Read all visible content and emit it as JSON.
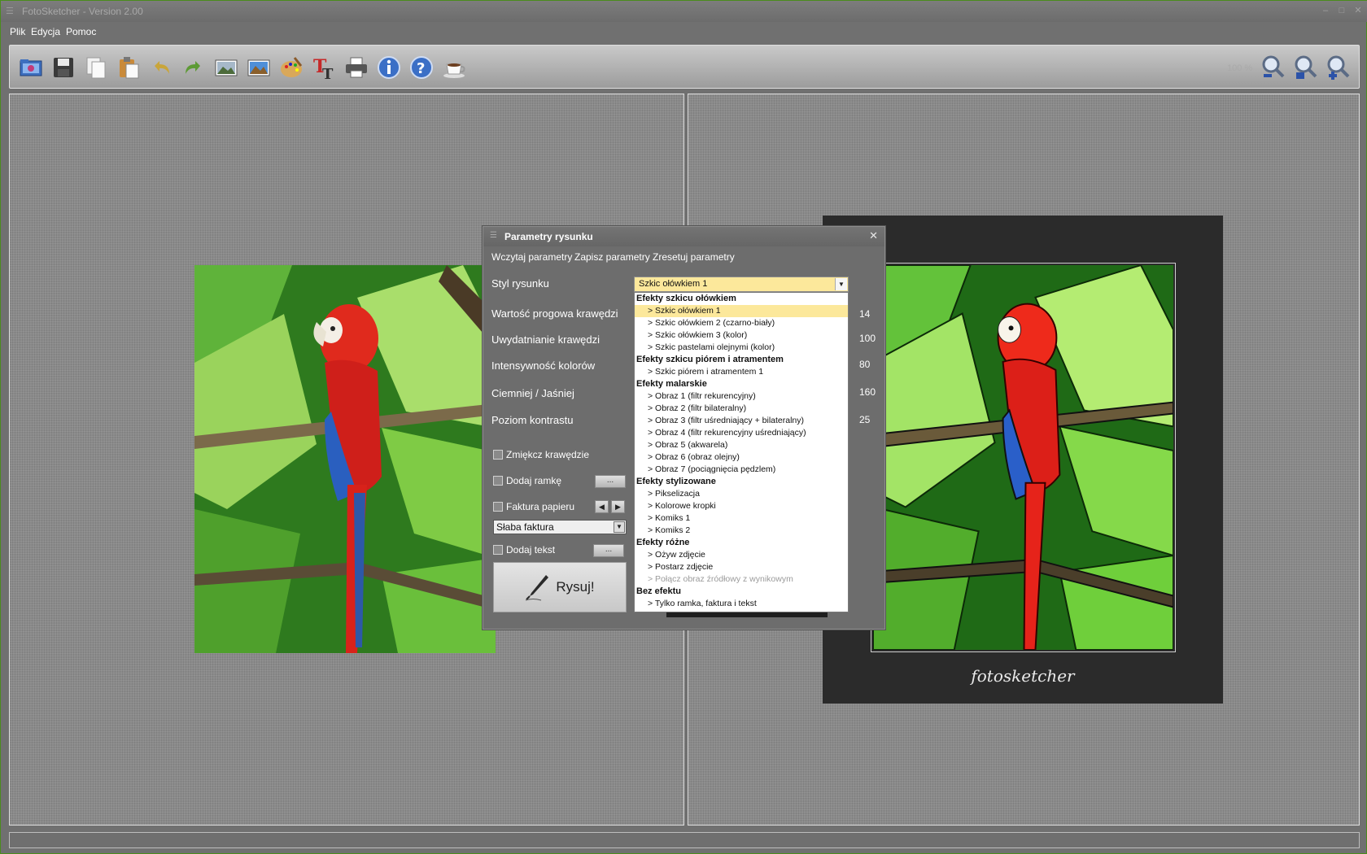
{
  "window": {
    "title": "FotoSketcher - Version 2.00"
  },
  "menu": [
    "Plik",
    "Edycja",
    "Pomoc"
  ],
  "toolbar": {
    "icons": [
      "open-icon",
      "save-icon",
      "copy-icon",
      "paste-icon",
      "undo-icon",
      "redo-icon",
      "source-image-icon",
      "result-image-icon",
      "palette-icon",
      "text-icon",
      "print-icon",
      "info-icon",
      "help-icon",
      "coffee-icon"
    ],
    "zoom_level": "100 %",
    "zoom_icons": [
      "zoom-out-icon",
      "zoom-fit-icon",
      "zoom-in-icon"
    ]
  },
  "right_image": {
    "signature": "fotosketcher"
  },
  "dialog": {
    "title": "Parametry rysunku",
    "links": {
      "load": "Wczytaj parametry",
      "save": "Zapisz parametry",
      "reset": "Zresetuj parametry"
    },
    "style_label": "Styl rysunku",
    "style_selected": "Szkic ołówkiem 1",
    "params": [
      {
        "label": "Wartość progowa krawędzi",
        "value": "14"
      },
      {
        "label": "Uwydatnianie krawędzi",
        "value": "100"
      },
      {
        "label": "Intensywność kolorów",
        "value": "80"
      },
      {
        "label": "Ciemniej / Jaśniej",
        "value": "160"
      },
      {
        "label": "Poziom kontrastu",
        "value": "25"
      }
    ],
    "checkboxes": {
      "soften": "Zmiękcz krawędzie",
      "frame": "Dodaj ramkę",
      "paper": "Faktura papieru",
      "text": "Dodaj tekst"
    },
    "dots": "...",
    "texture_value": "Słaba faktura",
    "draw_button": "Rysuj!",
    "style_list": [
      {
        "type": "group",
        "label": "Efekty szkicu ołówkiem"
      },
      {
        "type": "item",
        "label": ">  Szkic ołówkiem 1",
        "selected": true
      },
      {
        "type": "item",
        "label": ">  Szkic ołówkiem 2 (czarno-biały)"
      },
      {
        "type": "item",
        "label": ">  Szkic ołówkiem 3 (kolor)"
      },
      {
        "type": "item",
        "label": ">  Szkic pastelami olejnymi (kolor)"
      },
      {
        "type": "group",
        "label": "Efekty szkicu piórem i atramentem"
      },
      {
        "type": "item",
        "label": ">  Szkic piórem i atramentem 1"
      },
      {
        "type": "group",
        "label": "Efekty malarskie"
      },
      {
        "type": "item",
        "label": ">  Obraz 1 (filtr rekurencyjny)"
      },
      {
        "type": "item",
        "label": ">  Obraz 2 (filtr bilateralny)"
      },
      {
        "type": "item",
        "label": ">  Obraz 3 (filtr uśredniający + bilateralny)"
      },
      {
        "type": "item",
        "label": ">  Obraz 4 (filtr rekurencyjny uśredniający)"
      },
      {
        "type": "item",
        "label": ">  Obraz 5 (akwarela)"
      },
      {
        "type": "item",
        "label": ">  Obraz 6 (obraz olejny)"
      },
      {
        "type": "item",
        "label": ">  Obraz 7 (pociągnięcia pędzlem)"
      },
      {
        "type": "group",
        "label": "Efekty stylizowane"
      },
      {
        "type": "item",
        "label": ">  Pikselizacja"
      },
      {
        "type": "item",
        "label": ">  Kolorowe kropki"
      },
      {
        "type": "item",
        "label": ">  Komiks 1"
      },
      {
        "type": "item",
        "label": ">  Komiks 2"
      },
      {
        "type": "group",
        "label": "Efekty różne"
      },
      {
        "type": "item",
        "label": ">  Ożyw zdjęcie"
      },
      {
        "type": "item",
        "label": ">  Postarz zdjęcie"
      },
      {
        "type": "item",
        "label": ">  Połącz obraz źródłowy z wynikowym",
        "disabled": true
      },
      {
        "type": "group",
        "label": "Bez efektu"
      },
      {
        "type": "item",
        "label": ">  Tylko ramka, faktura i tekst"
      }
    ]
  },
  "colors": {
    "accent": "#fce89b",
    "panel_bg": "#8a8a8a",
    "dialog_bg": "#6d6d6d"
  }
}
